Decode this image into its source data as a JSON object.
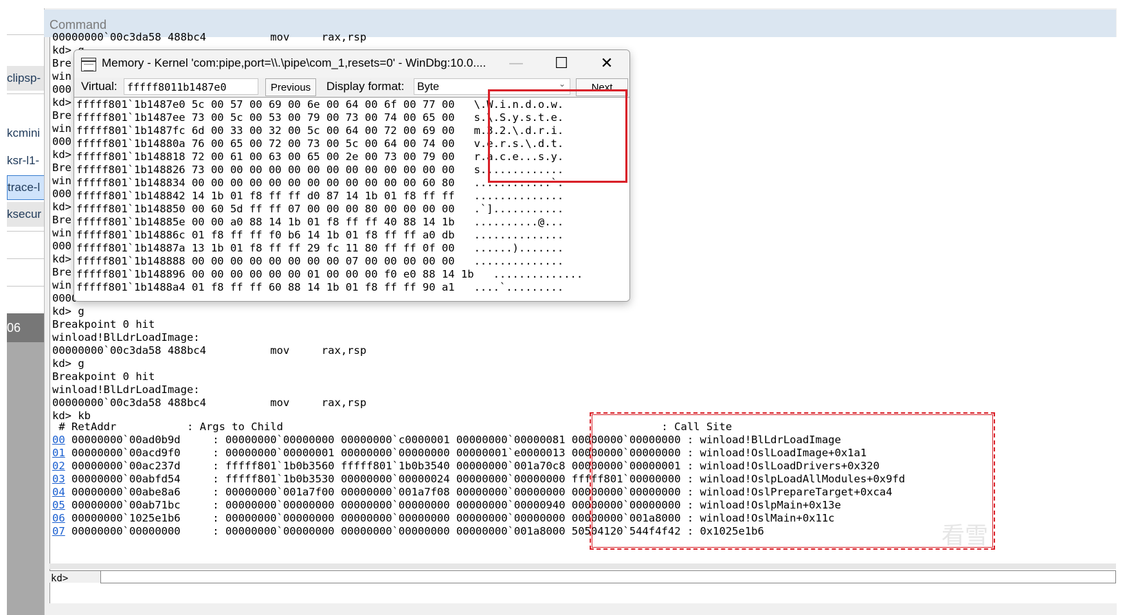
{
  "sidebar": {
    "items": [
      "clipsp-",
      "kcmini",
      "ksr-l1-",
      "trace-l",
      "ksecur"
    ],
    "number": "06"
  },
  "command": {
    "title": "Command",
    "prompt": "kd>",
    "lines": [
      "00000000`00c3da58 488bc4          mov     rax,rsp",
      "kd> g",
      "Bre",
      "win",
      "000",
      "kd>",
      "Bre",
      "win",
      "000",
      "kd>",
      "Bre",
      "win",
      "000",
      "kd>",
      "Bre",
      "win",
      "000",
      "kd>",
      "Bre",
      "win",
      "0000",
      "kd> g",
      "Breakpoint 0 hit",
      "winload!BlLdrLoadImage:",
      "00000000`00c3da58 488bc4          mov     rax,rsp",
      "kd> g",
      "Breakpoint 0 hit",
      "winload!BlLdrLoadImage:",
      "00000000`00c3da58 488bc4          mov     rax,rsp",
      "kd> kb"
    ],
    "stack_header": " # RetAddr           : Args to Child                                                           : Call Site",
    "stack_rows": [
      {
        "idx": "00",
        "rest": " 00000000`00ad0b9d     : 00000000`00000000 00000000`c0000001 00000000`00000081 00000000`00000000 : winload!BlLdrLoadImage"
      },
      {
        "idx": "01",
        "rest": " 00000000`00acd9f0     : 00000000`00000001 00000000`00000000 00000001`e0000013 00000000`00000000 : winload!OslLoadImage+0x1a1"
      },
      {
        "idx": "02",
        "rest": " 00000000`00ac237d     : fffff801`1b0b3560 fffff801`1b0b3540 00000000`001a70c8 00000000`00000001 : winload!OslLoadDrivers+0x320"
      },
      {
        "idx": "03",
        "rest": " 00000000`00abfd54     : fffff801`1b0b3530 00000000`00000024 00000000`00000000 fffff801`00000000 : winload!OslpLoadAllModules+0x9fd"
      },
      {
        "idx": "04",
        "rest": " 00000000`00abe8a6     : 00000000`001a7f00 00000000`001a7f08 00000000`00000000 00000000`00000000 : winload!OslPrepareTarget+0xca4"
      },
      {
        "idx": "05",
        "rest": " 00000000`00ab71bc     : 00000000`00000000 00000000`00000000 00000000`00000940 00000000`00000000 : winload!OslpMain+0x13e"
      },
      {
        "idx": "06",
        "rest": " 00000000`1025e1b6     : 00000000`00000000 00000000`00000000 00000000`00000000 00000000`001a8000 : winload!OslMain+0x11c"
      },
      {
        "idx": "07",
        "rest": " 00000000`00000000     : 00000000`00000000 00000000`00000000 00000000`001a8000 50504120`544f4f42 : 0x1025e1b6"
      }
    ]
  },
  "memory": {
    "title": "Memory - Kernel 'com:pipe,port=\\\\.\\pipe\\com_1,resets=0' - WinDbg:10.0....",
    "minimize": "—",
    "maximize": "☐",
    "close": "✕",
    "virtual_label": "Virtual:",
    "virtual_value": "fffff8011b1487e0",
    "previous_label": "Previous",
    "display_format_label": "Display format:",
    "display_format_value": "Byte",
    "next_label": "Next",
    "rows": [
      "fffff801`1b1487e0 5c 00 57 00 69 00 6e 00 64 00 6f 00 77 00   \\.W.i.n.d.o.w.",
      "fffff801`1b1487ee 73 00 5c 00 53 00 79 00 73 00 74 00 65 00   s.\\.S.y.s.t.e.",
      "fffff801`1b1487fc 6d 00 33 00 32 00 5c 00 64 00 72 00 69 00   m.3.2.\\.d.r.i.",
      "fffff801`1b14880a 76 00 65 00 72 00 73 00 5c 00 64 00 74 00   v.e.r.s.\\.d.t.",
      "fffff801`1b148818 72 00 61 00 63 00 65 00 2e 00 73 00 79 00   r.a.c.e...s.y.",
      "fffff801`1b148826 73 00 00 00 00 00 00 00 00 00 00 00 00 00   s.............",
      "fffff801`1b148834 00 00 00 00 00 00 00 00 00 00 00 00 60 80   ............`.",
      "fffff801`1b148842 14 1b 01 f8 ff ff d0 87 14 1b 01 f8 ff ff   ..............",
      "fffff801`1b148850 00 60 5d ff ff 07 00 00 00 80 00 00 00 00   .`]...........",
      "fffff801`1b14885e 00 00 a0 88 14 1b 01 f8 ff ff 40 88 14 1b   ..........@...",
      "fffff801`1b14886c 01 f8 ff ff f0 b6 14 1b 01 f8 ff ff a0 db   ..............",
      "fffff801`1b14887a 13 1b 01 f8 ff ff 29 fc 11 80 ff ff 0f 00   ......).......",
      "fffff801`1b148888 00 00 00 00 00 00 00 00 07 00 00 00 00 00   ..............",
      "fffff801`1b148896 00 00 00 00 00 00 01 00 00 00 f0 e0 88 14 1b   ..............",
      "fffff801`1b1488a4 01 f8 ff ff 60 88 14 1b 01 f8 ff ff 90 a1   ....`........."
    ]
  },
  "watermark": "看雪",
  "colors": {
    "highlight": "#d9222a",
    "link": "#1a5fd0"
  }
}
